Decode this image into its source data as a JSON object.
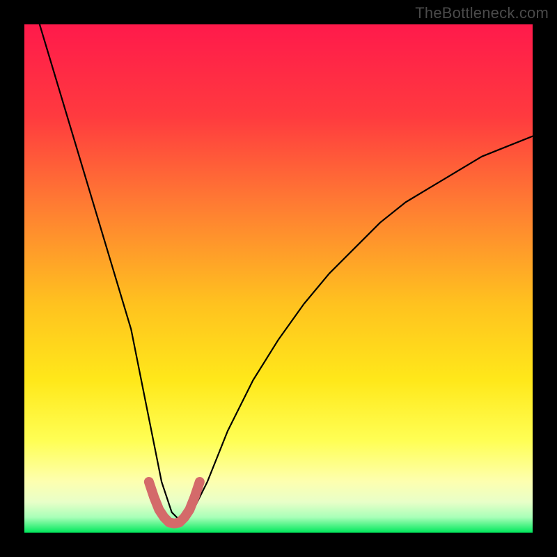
{
  "watermark": "TheBottleneck.com",
  "chart_data": {
    "type": "line",
    "title": "",
    "xlabel": "",
    "ylabel": "",
    "xlim": [
      0,
      100
    ],
    "ylim": [
      0,
      100
    ],
    "background_gradient": {
      "top_color": "#ff1a4b",
      "upper_mid_color": "#ff6a33",
      "mid_color": "#ffd400",
      "lower_mid_color": "#ffff66",
      "near_bottom_color": "#f7ffb0",
      "bottom_color": "#00e85c"
    },
    "series": [
      {
        "name": "bottleneck-curve",
        "color": "#000000",
        "x": [
          3,
          6,
          9,
          12,
          15,
          18,
          21,
          23,
          25,
          27,
          29,
          31,
          33,
          36,
          40,
          45,
          50,
          55,
          60,
          65,
          70,
          75,
          80,
          85,
          90,
          95,
          100
        ],
        "y": [
          100,
          90,
          80,
          70,
          60,
          50,
          40,
          30,
          20,
          10,
          4,
          2,
          4,
          10,
          20,
          30,
          38,
          45,
          51,
          56,
          61,
          65,
          68,
          71,
          74,
          76,
          78
        ]
      },
      {
        "name": "highlight-band",
        "color": "#d46a6a",
        "stroke_width": 14,
        "x": [
          24.5,
          25.5,
          26.5,
          27.5,
          28.5,
          29.5,
          30.5,
          31.5,
          32.5,
          33.5,
          34.5
        ],
        "y": [
          10,
          7,
          4.5,
          3,
          2,
          1.8,
          2,
          3,
          4.5,
          7,
          10
        ]
      }
    ],
    "minimum": {
      "x": 29.5,
      "y": 1.8
    }
  }
}
